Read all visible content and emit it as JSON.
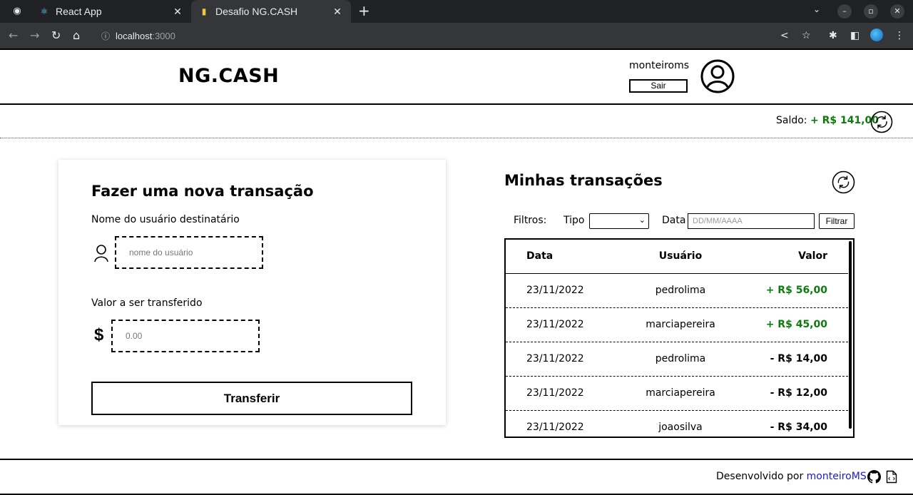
{
  "browser": {
    "tabs": [
      {
        "title": "React App",
        "active": false
      },
      {
        "title": "Desafio NG.CASH",
        "active": true
      }
    ],
    "url_host": "localhost",
    "url_port": ":3000"
  },
  "header": {
    "brand": "NG.CASH",
    "username": "monteiroms",
    "logout_label": "Sair"
  },
  "balance": {
    "label": "Saldo:",
    "value": "+ R$ 141,00"
  },
  "transfer_form": {
    "title": "Fazer uma nova transação",
    "recipient_label": "Nome do usuário destinatário",
    "recipient_placeholder": "nome do usuário",
    "amount_label": "Valor a ser transferido",
    "currency_symbol": "$",
    "amount_placeholder": "0.00",
    "submit_label": "Transferir"
  },
  "transactions": {
    "title": "Minhas transações",
    "filters_label": "Filtros:",
    "type_label": "Tipo",
    "type_selected": "",
    "date_label": "Data",
    "date_placeholder": "DD/MM/AAAA",
    "filter_button": "Filtrar",
    "columns": [
      "Data",
      "Usuário",
      "Valor"
    ],
    "rows": [
      {
        "date": "23/11/2022",
        "user": "pedrolima",
        "value": "+ R$ 56,00",
        "positive": true
      },
      {
        "date": "23/11/2022",
        "user": "marciapereira",
        "value": "+ R$ 45,00",
        "positive": true
      },
      {
        "date": "23/11/2022",
        "user": "pedrolima",
        "value": "- R$ 14,00",
        "positive": false
      },
      {
        "date": "23/11/2022",
        "user": "marciapereira",
        "value": "- R$ 12,00",
        "positive": false
      },
      {
        "date": "23/11/2022",
        "user": "joaosilva",
        "value": "- R$ 34,00",
        "positive": false
      }
    ]
  },
  "footer": {
    "text": "Desenvolvido por",
    "author": "monteiroMS"
  },
  "colors": {
    "positive": "#0c7a0c",
    "link": "#1a1ad0",
    "chrome_dark": "#202124"
  }
}
